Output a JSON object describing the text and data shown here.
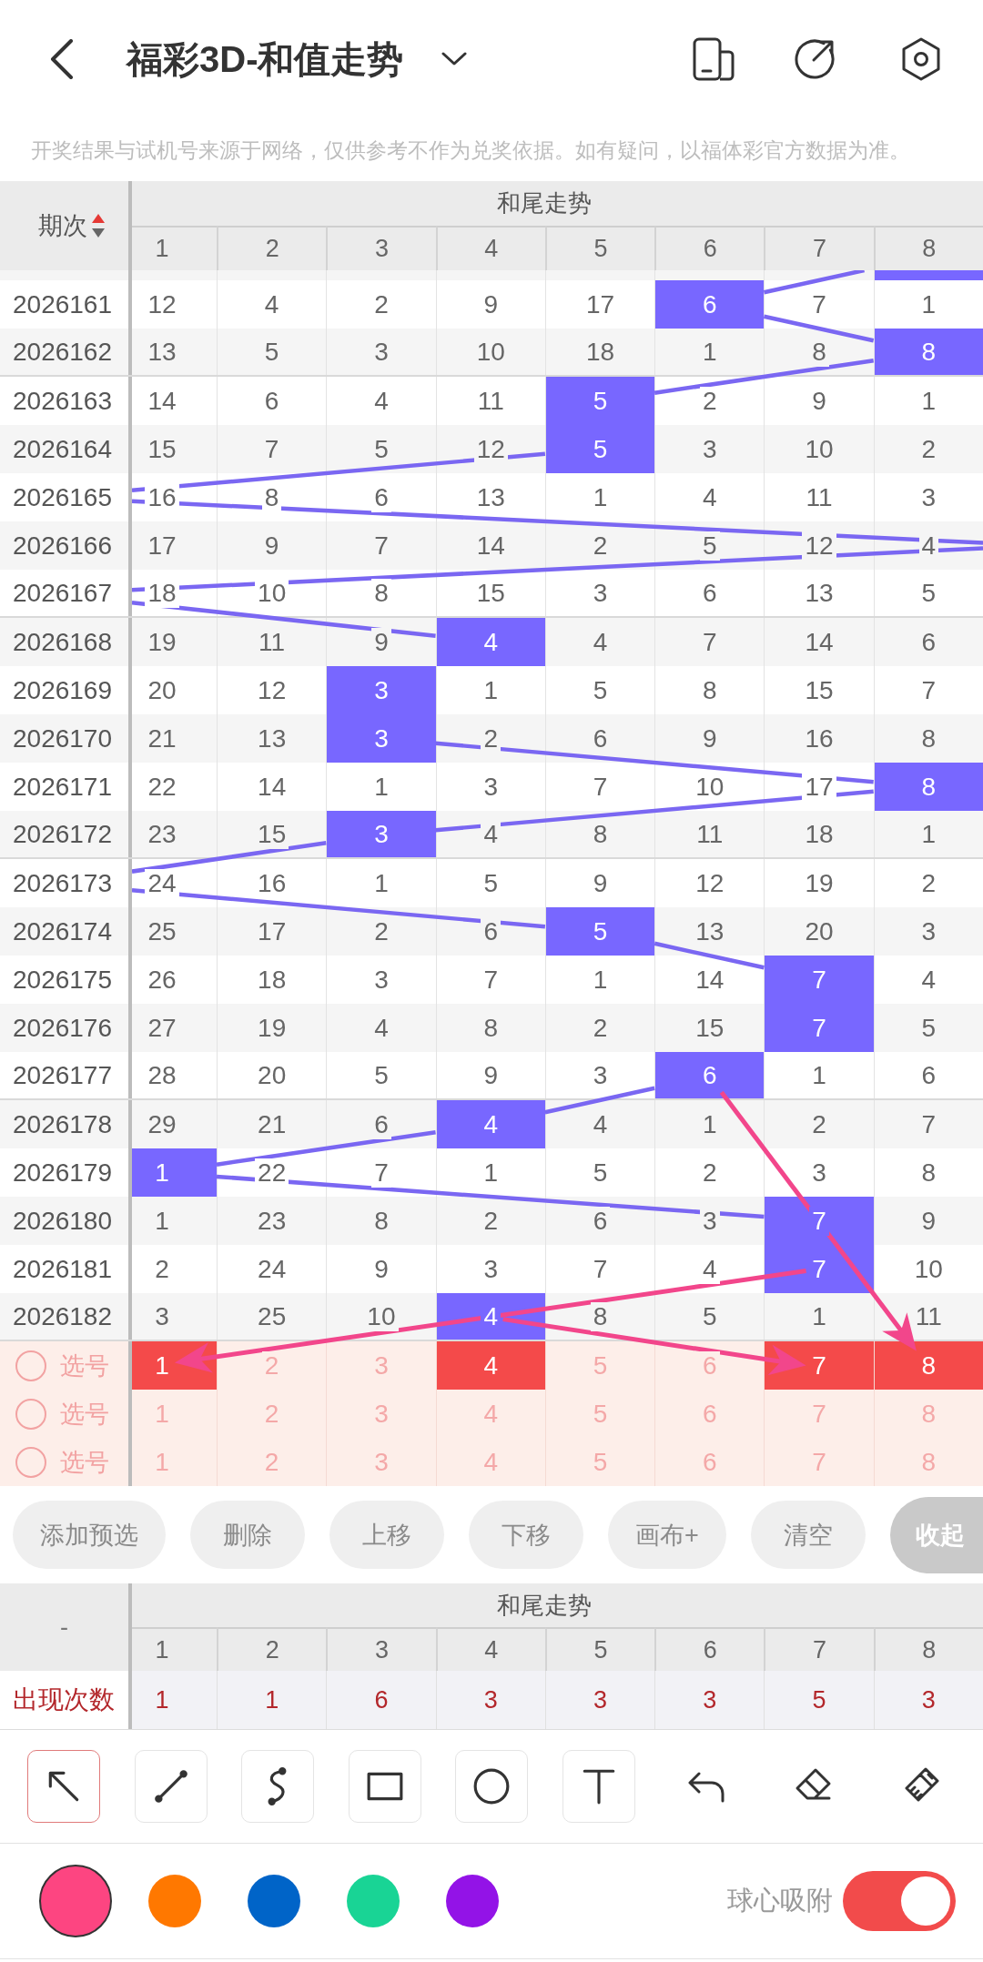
{
  "header": {
    "title": "福彩3D-和值走势"
  },
  "notice": "开奖结果与试机号来源于网络，仅供参考不作为兑奖依据。如有疑问，以福体彩官方数据为准。",
  "trend_table": {
    "period_header": "期次",
    "sorted_ascending": true,
    "group_header": "和尾走势",
    "columns": [
      "1",
      "2",
      "3",
      "4",
      "5",
      "6",
      "7",
      "8"
    ],
    "clipped_row": {
      "cells": [
        {
          "hit": false
        },
        {
          "hit": false
        },
        {
          "hit": false
        },
        {
          "hit": false
        },
        {
          "hit": false
        },
        {
          "hit": false
        },
        {
          "hit": false
        },
        {
          "hit": true
        }
      ]
    },
    "rows": [
      {
        "period": "2026161",
        "cells": [
          {
            "value": "12",
            "hit": false
          },
          {
            "value": "4",
            "hit": false
          },
          {
            "value": "2",
            "hit": false
          },
          {
            "value": "9",
            "hit": false
          },
          {
            "value": "17",
            "hit": false
          },
          {
            "value": "6",
            "hit": true
          },
          {
            "value": "7",
            "hit": false
          },
          {
            "value": "1",
            "hit": false
          }
        ]
      },
      {
        "period": "2026162",
        "cells": [
          {
            "value": "13",
            "hit": false
          },
          {
            "value": "5",
            "hit": false
          },
          {
            "value": "3",
            "hit": false
          },
          {
            "value": "10",
            "hit": false
          },
          {
            "value": "18",
            "hit": false
          },
          {
            "value": "1",
            "hit": false
          },
          {
            "value": "8",
            "hit": false
          },
          {
            "value": "8",
            "hit": true
          }
        ]
      },
      {
        "period": "2026163",
        "cells": [
          {
            "value": "14",
            "hit": false
          },
          {
            "value": "6",
            "hit": false
          },
          {
            "value": "4",
            "hit": false
          },
          {
            "value": "11",
            "hit": false
          },
          {
            "value": "5",
            "hit": true
          },
          {
            "value": "2",
            "hit": false
          },
          {
            "value": "9",
            "hit": false
          },
          {
            "value": "1",
            "hit": false
          }
        ]
      },
      {
        "period": "2026164",
        "cells": [
          {
            "value": "15",
            "hit": false
          },
          {
            "value": "7",
            "hit": false
          },
          {
            "value": "5",
            "hit": false
          },
          {
            "value": "12",
            "hit": false
          },
          {
            "value": "5",
            "hit": true
          },
          {
            "value": "3",
            "hit": false
          },
          {
            "value": "10",
            "hit": false
          },
          {
            "value": "2",
            "hit": false
          }
        ]
      },
      {
        "period": "2026165",
        "exits_left": true,
        "cells": [
          {
            "value": "16",
            "hit": false
          },
          {
            "value": "8",
            "hit": false
          },
          {
            "value": "6",
            "hit": false
          },
          {
            "value": "13",
            "hit": false
          },
          {
            "value": "1",
            "hit": false
          },
          {
            "value": "4",
            "hit": false
          },
          {
            "value": "11",
            "hit": false
          },
          {
            "value": "3",
            "hit": false
          }
        ]
      },
      {
        "period": "2026166",
        "exits_right": true,
        "cells": [
          {
            "value": "17",
            "hit": false
          },
          {
            "value": "9",
            "hit": false
          },
          {
            "value": "7",
            "hit": false
          },
          {
            "value": "14",
            "hit": false
          },
          {
            "value": "2",
            "hit": false
          },
          {
            "value": "5",
            "hit": false
          },
          {
            "value": "12",
            "hit": false
          },
          {
            "value": "4",
            "hit": false
          }
        ]
      },
      {
        "period": "2026167",
        "exits_left": true,
        "cells": [
          {
            "value": "18",
            "hit": false
          },
          {
            "value": "10",
            "hit": false
          },
          {
            "value": "8",
            "hit": false
          },
          {
            "value": "15",
            "hit": false
          },
          {
            "value": "3",
            "hit": false
          },
          {
            "value": "6",
            "hit": false
          },
          {
            "value": "13",
            "hit": false
          },
          {
            "value": "5",
            "hit": false
          }
        ]
      },
      {
        "period": "2026168",
        "cells": [
          {
            "value": "19",
            "hit": false
          },
          {
            "value": "11",
            "hit": false
          },
          {
            "value": "9",
            "hit": false
          },
          {
            "value": "4",
            "hit": true
          },
          {
            "value": "4",
            "hit": false
          },
          {
            "value": "7",
            "hit": false
          },
          {
            "value": "14",
            "hit": false
          },
          {
            "value": "6",
            "hit": false
          }
        ]
      },
      {
        "period": "2026169",
        "cells": [
          {
            "value": "20",
            "hit": false
          },
          {
            "value": "12",
            "hit": false
          },
          {
            "value": "3",
            "hit": true
          },
          {
            "value": "1",
            "hit": false
          },
          {
            "value": "5",
            "hit": false
          },
          {
            "value": "8",
            "hit": false
          },
          {
            "value": "15",
            "hit": false
          },
          {
            "value": "7",
            "hit": false
          }
        ]
      },
      {
        "period": "2026170",
        "cells": [
          {
            "value": "21",
            "hit": false
          },
          {
            "value": "13",
            "hit": false
          },
          {
            "value": "3",
            "hit": true
          },
          {
            "value": "2",
            "hit": false
          },
          {
            "value": "6",
            "hit": false
          },
          {
            "value": "9",
            "hit": false
          },
          {
            "value": "16",
            "hit": false
          },
          {
            "value": "8",
            "hit": false
          }
        ]
      },
      {
        "period": "2026171",
        "cells": [
          {
            "value": "22",
            "hit": false
          },
          {
            "value": "14",
            "hit": false
          },
          {
            "value": "1",
            "hit": false
          },
          {
            "value": "3",
            "hit": false
          },
          {
            "value": "7",
            "hit": false
          },
          {
            "value": "10",
            "hit": false
          },
          {
            "value": "17",
            "hit": false
          },
          {
            "value": "8",
            "hit": true
          }
        ]
      },
      {
        "period": "2026172",
        "cells": [
          {
            "value": "23",
            "hit": false
          },
          {
            "value": "15",
            "hit": false
          },
          {
            "value": "3",
            "hit": true
          },
          {
            "value": "4",
            "hit": false
          },
          {
            "value": "8",
            "hit": false
          },
          {
            "value": "11",
            "hit": false
          },
          {
            "value": "18",
            "hit": false
          },
          {
            "value": "1",
            "hit": false
          }
        ]
      },
      {
        "period": "2026173",
        "exits_left": true,
        "cells": [
          {
            "value": "24",
            "hit": false
          },
          {
            "value": "16",
            "hit": false
          },
          {
            "value": "1",
            "hit": false
          },
          {
            "value": "5",
            "hit": false
          },
          {
            "value": "9",
            "hit": false
          },
          {
            "value": "12",
            "hit": false
          },
          {
            "value": "19",
            "hit": false
          },
          {
            "value": "2",
            "hit": false
          }
        ]
      },
      {
        "period": "2026174",
        "cells": [
          {
            "value": "25",
            "hit": false
          },
          {
            "value": "17",
            "hit": false
          },
          {
            "value": "2",
            "hit": false
          },
          {
            "value": "6",
            "hit": false
          },
          {
            "value": "5",
            "hit": true
          },
          {
            "value": "13",
            "hit": false
          },
          {
            "value": "20",
            "hit": false
          },
          {
            "value": "3",
            "hit": false
          }
        ]
      },
      {
        "period": "2026175",
        "cells": [
          {
            "value": "26",
            "hit": false
          },
          {
            "value": "18",
            "hit": false
          },
          {
            "value": "3",
            "hit": false
          },
          {
            "value": "7",
            "hit": false
          },
          {
            "value": "1",
            "hit": false
          },
          {
            "value": "14",
            "hit": false
          },
          {
            "value": "7",
            "hit": true
          },
          {
            "value": "4",
            "hit": false
          }
        ]
      },
      {
        "period": "2026176",
        "cells": [
          {
            "value": "27",
            "hit": false
          },
          {
            "value": "19",
            "hit": false
          },
          {
            "value": "4",
            "hit": false
          },
          {
            "value": "8",
            "hit": false
          },
          {
            "value": "2",
            "hit": false
          },
          {
            "value": "15",
            "hit": false
          },
          {
            "value": "7",
            "hit": true
          },
          {
            "value": "5",
            "hit": false
          }
        ]
      },
      {
        "period": "2026177",
        "cells": [
          {
            "value": "28",
            "hit": false
          },
          {
            "value": "20",
            "hit": false
          },
          {
            "value": "5",
            "hit": false
          },
          {
            "value": "9",
            "hit": false
          },
          {
            "value": "3",
            "hit": false
          },
          {
            "value": "6",
            "hit": true
          },
          {
            "value": "1",
            "hit": false
          },
          {
            "value": "6",
            "hit": false
          }
        ]
      },
      {
        "period": "2026178",
        "cells": [
          {
            "value": "29",
            "hit": false
          },
          {
            "value": "21",
            "hit": false
          },
          {
            "value": "6",
            "hit": false
          },
          {
            "value": "4",
            "hit": true
          },
          {
            "value": "4",
            "hit": false
          },
          {
            "value": "1",
            "hit": false
          },
          {
            "value": "2",
            "hit": false
          },
          {
            "value": "7",
            "hit": false
          }
        ]
      },
      {
        "period": "2026179",
        "cells": [
          {
            "value": "1",
            "hit": true
          },
          {
            "value": "22",
            "hit": false
          },
          {
            "value": "7",
            "hit": false
          },
          {
            "value": "1",
            "hit": false
          },
          {
            "value": "5",
            "hit": false
          },
          {
            "value": "2",
            "hit": false
          },
          {
            "value": "3",
            "hit": false
          },
          {
            "value": "8",
            "hit": false
          }
        ]
      },
      {
        "period": "2026180",
        "cells": [
          {
            "value": "1",
            "hit": false
          },
          {
            "value": "23",
            "hit": false
          },
          {
            "value": "8",
            "hit": false
          },
          {
            "value": "2",
            "hit": false
          },
          {
            "value": "6",
            "hit": false
          },
          {
            "value": "3",
            "hit": false
          },
          {
            "value": "7",
            "hit": true
          },
          {
            "value": "9",
            "hit": false
          }
        ]
      },
      {
        "period": "2026181",
        "cells": [
          {
            "value": "2",
            "hit": false
          },
          {
            "value": "24",
            "hit": false
          },
          {
            "value": "9",
            "hit": false
          },
          {
            "value": "3",
            "hit": false
          },
          {
            "value": "7",
            "hit": false
          },
          {
            "value": "4",
            "hit": false
          },
          {
            "value": "7",
            "hit": true
          },
          {
            "value": "10",
            "hit": false
          }
        ]
      },
      {
        "period": "2026182",
        "cells": [
          {
            "value": "3",
            "hit": false
          },
          {
            "value": "25",
            "hit": false
          },
          {
            "value": "10",
            "hit": false
          },
          {
            "value": "4",
            "hit": true
          },
          {
            "value": "8",
            "hit": false
          },
          {
            "value": "5",
            "hit": false
          },
          {
            "value": "1",
            "hit": false
          },
          {
            "value": "11",
            "hit": false
          }
        ]
      }
    ],
    "pick_rows": [
      {
        "label": "选号",
        "checked": false,
        "cells": [
          {
            "value": "1",
            "selected": true
          },
          {
            "value": "2",
            "selected": false
          },
          {
            "value": "3",
            "selected": false
          },
          {
            "value": "4",
            "selected": true
          },
          {
            "value": "5",
            "selected": false
          },
          {
            "value": "6",
            "selected": false
          },
          {
            "value": "7",
            "selected": true
          },
          {
            "value": "8",
            "selected": true
          }
        ]
      },
      {
        "label": "选号",
        "checked": false,
        "cells": [
          {
            "value": "1",
            "selected": false
          },
          {
            "value": "2",
            "selected": false
          },
          {
            "value": "3",
            "selected": false
          },
          {
            "value": "4",
            "selected": false
          },
          {
            "value": "5",
            "selected": false
          },
          {
            "value": "6",
            "selected": false
          },
          {
            "value": "7",
            "selected": false
          },
          {
            "value": "8",
            "selected": false
          }
        ]
      },
      {
        "label": "选号",
        "checked": false,
        "cells": [
          {
            "value": "1",
            "selected": false
          },
          {
            "value": "2",
            "selected": false
          },
          {
            "value": "3",
            "selected": false
          },
          {
            "value": "4",
            "selected": false
          },
          {
            "value": "5",
            "selected": false
          },
          {
            "value": "6",
            "selected": false
          },
          {
            "value": "7",
            "selected": false
          },
          {
            "value": "8",
            "selected": false
          }
        ]
      }
    ]
  },
  "annotations": [
    {
      "kind": "arrow",
      "color": "#f2468b"
    },
    {
      "kind": "arrow",
      "color": "#f2468b"
    },
    {
      "kind": "arrow",
      "color": "#f2468b"
    }
  ],
  "buttons": [
    {
      "label": "添加预选",
      "kind": "action"
    },
    {
      "label": "删除",
      "kind": "action"
    },
    {
      "label": "上移",
      "kind": "action"
    },
    {
      "label": "下移",
      "kind": "action"
    },
    {
      "label": "画布+",
      "kind": "action"
    },
    {
      "label": "清空",
      "kind": "action"
    },
    {
      "label": "收起",
      "kind": "collapse"
    }
  ],
  "stats_table": {
    "corner": "-",
    "group_header": "和尾走势",
    "columns": [
      "1",
      "2",
      "3",
      "4",
      "5",
      "6",
      "7",
      "8"
    ],
    "row": {
      "label": "出现次数",
      "values": [
        "1",
        "1",
        "6",
        "3",
        "3",
        "3",
        "5",
        "3"
      ]
    }
  },
  "drawing_tools": [
    {
      "kind": "arrow",
      "selected": true
    },
    {
      "kind": "line",
      "selected": false
    },
    {
      "kind": "curve",
      "selected": false
    },
    {
      "kind": "rectangle",
      "selected": false
    },
    {
      "kind": "ellipse",
      "selected": false
    },
    {
      "kind": "text",
      "selected": false
    }
  ],
  "tool_actions": [
    {
      "kind": "undo"
    },
    {
      "kind": "eraser"
    },
    {
      "kind": "brush"
    }
  ],
  "pen_colors": [
    {
      "color": "#fd4581",
      "selected": true
    },
    {
      "color": "#ff7800",
      "selected": false
    },
    {
      "color": "#0064c8",
      "selected": false
    },
    {
      "color": "#19d495",
      "selected": false
    },
    {
      "color": "#9313e7",
      "selected": false
    }
  ],
  "snap_toggle": {
    "label": "球心吸附",
    "on": true
  }
}
